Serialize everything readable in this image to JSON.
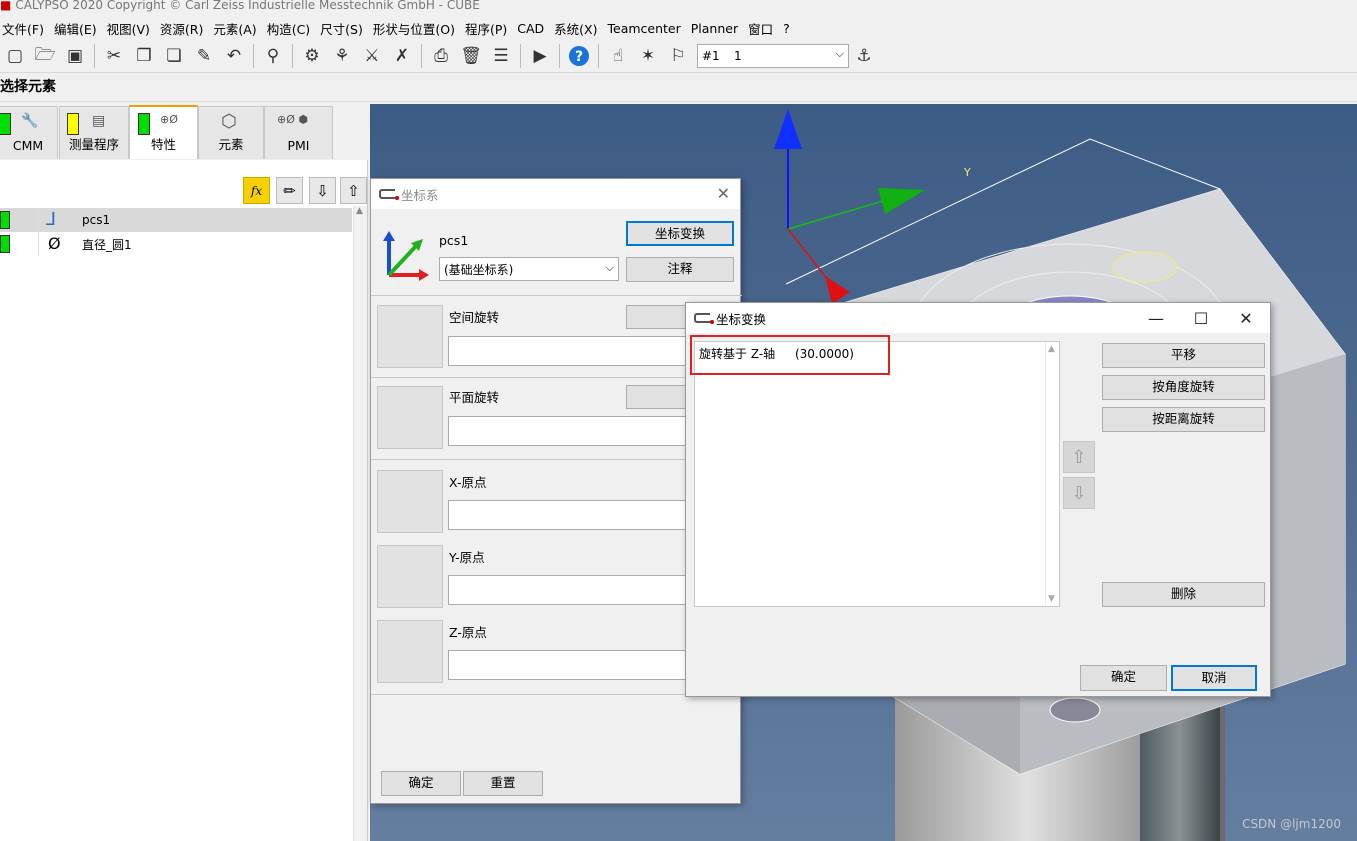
{
  "window_title": "CALYPSO 2020 Copyright © Carl Zeiss Industrielle Messtechnik GmbH - CUBE",
  "menu": [
    "文件(F)",
    "编辑(E)",
    "视图(V)",
    "资源(R)",
    "元素(A)",
    "构造(C)",
    "尺寸(S)",
    "形状与位置(O)",
    "程序(P)",
    "CAD",
    "系统(X)",
    "Teamcenter",
    "Planner",
    "窗口",
    "?"
  ],
  "toolbar": {
    "combo_value1": "#1",
    "combo_value2": "1",
    "combo_arrow": "⌵"
  },
  "panel_title": "选择元素",
  "tabs": [
    {
      "label": "CMM",
      "swatch": "#00dd00"
    },
    {
      "label": "测量程序",
      "swatch": "#ffff00"
    },
    {
      "label": "特性",
      "swatch": "#00dd00"
    },
    {
      "label": "元素",
      "swatch": ""
    },
    {
      "label": "PMI",
      "swatch": ""
    }
  ],
  "list_rows": [
    {
      "name": "pcs1",
      "icon": "coordinate-system-icon",
      "swatch": "#00dd00"
    },
    {
      "name": "直径_圆1",
      "icon": "diameter-icon",
      "swatch": "#00dd00"
    }
  ],
  "coord_dialog": {
    "title": "坐标系",
    "name": "pcs1",
    "base_select": "(基础坐标系)",
    "transform_button": "坐标变换",
    "comment_button": "注释",
    "sections": [
      "空间旋转",
      "平面旋转",
      "X-原点",
      "Y-原点",
      "Z-原点"
    ],
    "ok_button": "确定",
    "reset_button": "重置"
  },
  "transform_dialog": {
    "title": "坐标变换",
    "list_item_label": "旋转基于 Z-轴",
    "list_item_value": "(30.0000)",
    "buttons": {
      "translate": "平移",
      "rotate_angle": "按角度旋转",
      "rotate_distance": "按距离旋转",
      "delete": "删除",
      "ok": "确定",
      "cancel": "取消"
    }
  },
  "viewport": {
    "axis_label_y": "Y"
  },
  "watermark": "CSDN @ljm1200"
}
